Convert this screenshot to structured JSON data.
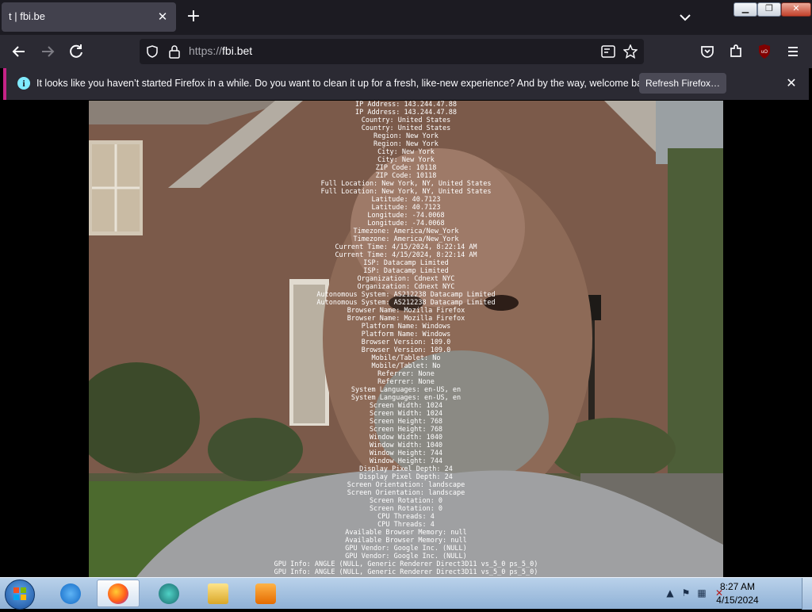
{
  "browser": {
    "tab": {
      "title": "t | fbi.be"
    },
    "url": {
      "scheme": "https://",
      "host": "fbi.bet"
    },
    "notification": {
      "message": "It looks like you haven’t started Firefox in a while. Do you want to clean it up for a fresh, like-new experience? And by the way, welcome back!",
      "button_label": "Refresh Firefox…"
    },
    "icons": {
      "back": "arrow-left-icon",
      "forward": "arrow-right-icon",
      "reload": "reload-icon",
      "tracking": "shield-icon",
      "lock": "lock-icon",
      "reader": "reader-view-icon",
      "bookmark": "star-icon",
      "pocket": "pocket-icon",
      "extensions": "puzzle-icon",
      "ublock": "ublock-icon",
      "menu": "hamburger-menu-icon"
    }
  },
  "content": {
    "info_lines": [
      "IP Address: 143.244.47.88",
      "IP Address: 143.244.47.88",
      "Country: United States",
      "Country: United States",
      "Region: New York",
      "Region: New York",
      "City: New York",
      "City: New York",
      "ZIP Code: 10118",
      "ZIP Code: 10118",
      "Full Location: New York, NY, United States",
      "Full Location: New York, NY, United States",
      "Latitude: 40.7123",
      "Latitude: 40.7123",
      "Longitude: -74.0068",
      "Longitude: -74.0068",
      "Timezone: America/New_York",
      "Timezone: America/New_York",
      "Current Time: 4/15/2024, 8:22:14 AM",
      "Current Time: 4/15/2024, 8:22:14 AM",
      "ISP: Datacamp Limited",
      "ISP: Datacamp Limited",
      "Organization: Cdnext NYC",
      "Organization: Cdnext NYC",
      "Autonomous System: AS212238 Datacamp Limited",
      "Autonomous System: AS212238 Datacamp Limited",
      "Browser Name: Mozilla Firefox",
      "Browser Name: Mozilla Firefox",
      "Platform Name: Windows",
      "Platform Name: Windows",
      "Browser Version: 109.0",
      "Browser Version: 109.0",
      "Mobile/Tablet: No",
      "Mobile/Tablet: No",
      "Referrer: None",
      "Referrer: None",
      "System Languages: en-US, en",
      "System Languages: en-US, en",
      "Screen Width: 1024",
      "Screen Width: 1024",
      "Screen Height: 768",
      "Screen Height: 768",
      "Window Width: 1040",
      "Window Width: 1040",
      "Window Height: 744",
      "Window Height: 744",
      "Display Pixel Depth: 24",
      "Display Pixel Depth: 24",
      "Screen Orientation: landscape",
      "Screen Orientation: landscape",
      "Screen Rotation: 0",
      "Screen Rotation: 0",
      "CPU Threads: 4",
      "CPU Threads: 4",
      "Available Browser Memory: null",
      "Available Browser Memory: null",
      "GPU Vendor: Google Inc. (NULL)",
      "GPU Vendor: Google Inc. (NULL)",
      "GPU Info: ANGLE (NULL, Generic Renderer Direct3D11 vs_5_0 ps_5_0)",
      "GPU Info: ANGLE (NULL, Generic Renderer Direct3D11 vs_5_0 ps_5_0)"
    ]
  },
  "taskbar": {
    "items": [
      {
        "name": "internet-explorer-icon"
      },
      {
        "name": "firefox-icon",
        "active": true
      },
      {
        "name": "app-icon"
      },
      {
        "name": "file-explorer-icon"
      },
      {
        "name": "media-player-icon"
      }
    ],
    "clock": {
      "time": "8:27 AM",
      "date": "4/15/2024"
    }
  },
  "colors": {
    "tab_bg": "#42414d",
    "chrome_bg": "#1c1b22",
    "toolbar_bg": "#2b2a33",
    "notification_accent": "#c62386",
    "taskbar": "#a7c3e3"
  }
}
